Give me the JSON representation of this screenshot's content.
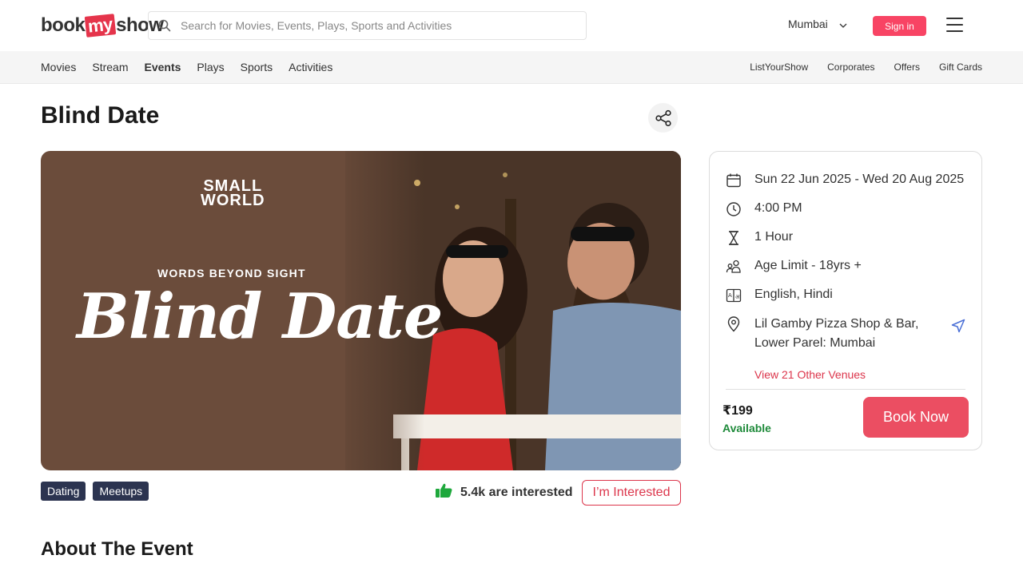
{
  "header": {
    "logo": {
      "part1": "book",
      "part2": "my",
      "part3": "show"
    },
    "search_placeholder": "Search for Movies, Events, Plays, Sports and Activities",
    "city": "Mumbai",
    "signin_label": "Sign in"
  },
  "nav": {
    "left": [
      "Movies",
      "Stream",
      "Events",
      "Plays",
      "Sports",
      "Activities"
    ],
    "active": "Events",
    "right": [
      "ListYourShow",
      "Corporates",
      "Offers",
      "Gift Cards"
    ]
  },
  "event": {
    "title": "Blind Date",
    "banner": {
      "brand_line1": "SMALL",
      "brand_line2": "WORLD",
      "tagline": "WORDS BEYOND SIGHT",
      "script_title": "Blind Date"
    },
    "tags": [
      "Dating",
      "Meetups"
    ],
    "interested_count": "5.4k are interested",
    "interested_button": "I’m Interested",
    "about_heading": "About The Event"
  },
  "details": {
    "dates": "Sun 22 Jun 2025 - Wed 20 Aug 2025",
    "time": "4:00 PM",
    "duration": "1 Hour",
    "age": "Age Limit - 18yrs +",
    "languages": "English, Hindi",
    "venue_line1": "Lil Gamby Pizza Shop & Bar,",
    "venue_line2": "Lower Parel: Mumbai",
    "other_venues": "View 21 Other Venues",
    "price": "₹199",
    "availability": "Available",
    "book_label": "Book Now"
  },
  "colors": {
    "brand_red": "#f84464",
    "tag_bg": "#2c3450",
    "available_green": "#1e8a3a",
    "thumb_green": "#1ea83c"
  }
}
